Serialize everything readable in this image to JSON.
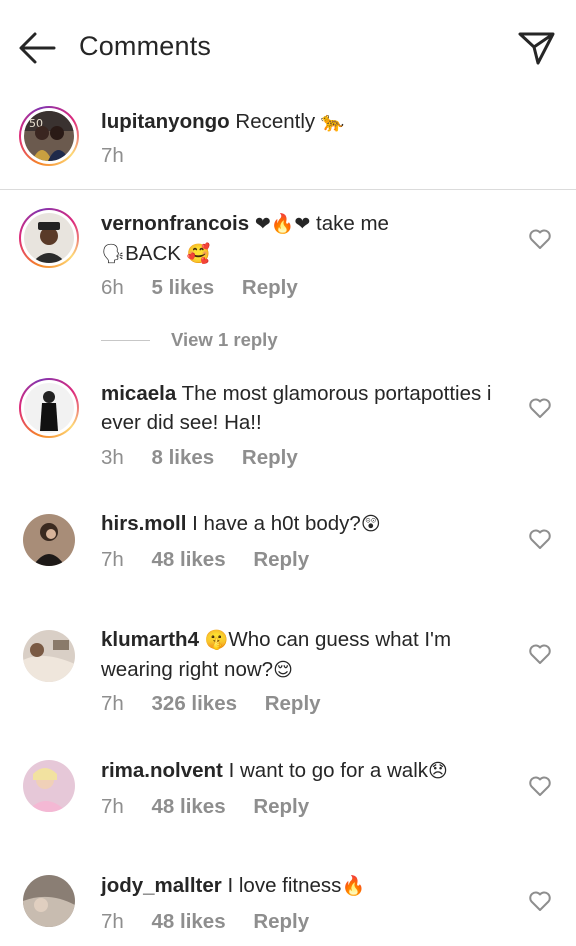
{
  "header": {
    "title": "Comments",
    "back_icon": "arrow-left-icon",
    "share_icon": "paper-plane-icon"
  },
  "caption": {
    "username": "lupitanyongo",
    "text": "Recently",
    "emoji": "🐆",
    "time": "7h"
  },
  "comments": [
    {
      "username": "vernonfrancois",
      "text_parts": [
        "❤🔥❤",
        " take me",
        "🗣",
        "BACK ",
        "🥰"
      ],
      "time": "6h",
      "likes": "5 likes",
      "reply": "Reply",
      "view_replies": "View 1 reply"
    },
    {
      "username": "micaela",
      "text": "The most glamorous portapotties i ever did see! Ha!!",
      "time": "3h",
      "likes": "8 likes",
      "reply": "Reply"
    },
    {
      "username": "hirs.moll",
      "text": "I have a h0t body?",
      "emoji": "😲",
      "time": "7h",
      "likes": "48 likes",
      "reply": "Reply"
    },
    {
      "username": "klumarth4",
      "emoji_pre": "🤫",
      "text": "Who can guess what I'm wearing right now?",
      "emoji": "😌",
      "time": "7h",
      "likes": "326 likes",
      "reply": "Reply"
    },
    {
      "username": "rima.nolvent",
      "text": "I want to go for a walk",
      "emoji": "😞",
      "time": "7h",
      "likes": "48 likes",
      "reply": "Reply"
    },
    {
      "username": "jody_mallter",
      "text": "I love fitness",
      "emoji": "🔥",
      "time": "7h",
      "likes": "48 likes",
      "reply": "Reply"
    }
  ],
  "colors": {
    "text": "#262626",
    "meta": "#8e8e8e",
    "divider": "#dbdbdb",
    "heart_stroke": "#8e8e8e"
  }
}
